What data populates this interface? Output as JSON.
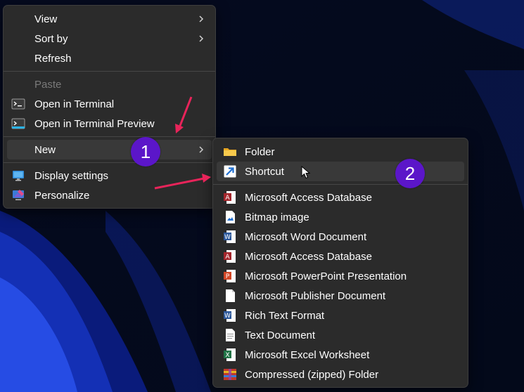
{
  "context_menu": {
    "items": [
      {
        "label": "View",
        "has_submenu": true
      },
      {
        "label": "Sort by",
        "has_submenu": true
      },
      {
        "label": "Refresh"
      },
      {
        "label": "Paste",
        "disabled": true
      },
      {
        "label": "Open in Terminal",
        "icon": "terminal-icon"
      },
      {
        "label": "Open in Terminal Preview",
        "icon": "terminal-preview-icon"
      },
      {
        "label": "New",
        "has_submenu": true,
        "highlighted": true
      },
      {
        "label": "Display settings",
        "icon": "display-settings-icon"
      },
      {
        "label": "Personalize",
        "icon": "personalize-icon"
      }
    ]
  },
  "new_submenu": {
    "items": [
      {
        "label": "Folder",
        "icon": "folder-icon"
      },
      {
        "label": "Shortcut",
        "icon": "shortcut-icon",
        "highlighted": true
      },
      {
        "label": "Microsoft Access Database",
        "icon": "access-icon"
      },
      {
        "label": "Bitmap image",
        "icon": "bitmap-icon"
      },
      {
        "label": "Microsoft Word Document",
        "icon": "word-icon"
      },
      {
        "label": "Microsoft Access Database",
        "icon": "access-icon"
      },
      {
        "label": "Microsoft PowerPoint Presentation",
        "icon": "powerpoint-icon"
      },
      {
        "label": "Microsoft Publisher Document",
        "icon": "publisher-icon"
      },
      {
        "label": "Rich Text Format",
        "icon": "word-icon"
      },
      {
        "label": "Text Document",
        "icon": "text-document-icon"
      },
      {
        "label": "Microsoft Excel Worksheet",
        "icon": "excel-icon"
      },
      {
        "label": "Compressed (zipped) Folder",
        "icon": "zip-folder-icon"
      }
    ]
  },
  "annotations": {
    "step1": "1",
    "step2": "2",
    "badge_color": "#5b16c9",
    "arrow_color": "#e8245a"
  }
}
